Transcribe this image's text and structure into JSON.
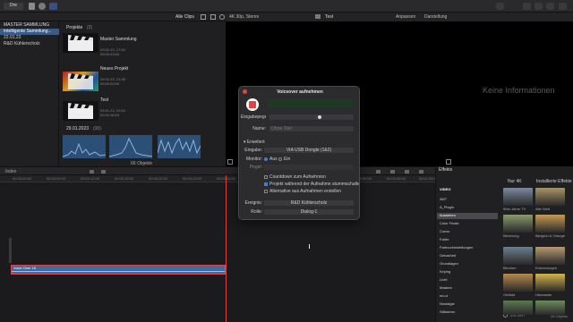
{
  "toolbar": {
    "left_label": "Dre",
    "keywords_clips": "Alle Clips",
    "viewer_format": "4K 30p, Stereo",
    "project_name": "Test",
    "view_menu": "Anpassen",
    "display_menu": "Darstellung"
  },
  "libraries": {
    "header": "MASTER SAMMLUNG",
    "items": [
      {
        "label": "Intelligente Sammlung..."
      },
      {
        "label": "22.01.23"
      },
      {
        "label": "R&D Kühlerscholz"
      }
    ]
  },
  "browser": {
    "projects_header": "Projekte",
    "projects_count": "(3)",
    "projects": [
      {
        "name": "Master Sammlung",
        "date": "29.01.23, 17:54",
        "duration": "00:00:43:03"
      },
      {
        "name": "Neues Projekt",
        "date": "29.01.23, 21:48",
        "duration": "00:00:00:00"
      },
      {
        "name": "Test",
        "date": "29.01.23, 21:53",
        "duration": "00:01:08:16"
      }
    ],
    "date_group": "29.01.2023",
    "date_group_count": "(30)",
    "footer": "66 Objekte"
  },
  "viewer": {
    "no_info": "Keine Informationen"
  },
  "timeline": {
    "label": "Index",
    "ruler_ticks": [
      "00:00:00:00",
      "00:00:05:00",
      "00:00:10:00",
      "00:00:15:00",
      "00:00:20:00",
      "00:00:25:00",
      "00:00:30:00",
      "00:00:35:00",
      "00:00:40:00",
      "00:00:45:00",
      "00:00:50:00",
      "00:00:55:00",
      "00:01:00:00"
    ],
    "clip_label": "Voice Over 16"
  },
  "dialog": {
    "title": "Voiceover aufnehmen",
    "input_level_label": "Eingabepegel",
    "name_label": "Name:",
    "name_placeholder": "Ohne Titel",
    "advanced_label": "Erweitert",
    "input_label": "Eingabe:",
    "input_value": "VIA USB Dongle (1&2)",
    "monitor_label": "Monitor:",
    "monitor_off": "Aus",
    "monitor_on": "Ein",
    "gain_label": "Pegel:",
    "check_countdown": "Countdown zum Aufnehmen",
    "check_mute": "Projekt während der Aufnahme stummschalten",
    "check_takes": "Alternative aus Aufnahmen erstellen",
    "event_label": "Ereignis:",
    "event_value": "R&D Kühlerscholz",
    "role_label": "Rolle:",
    "role_value": "Dialog-1"
  },
  "effects": {
    "title": "Effekte",
    "only_4k": "Nur 4K",
    "all_effects": "Installierte Effekte",
    "categories": [
      "VIDEO",
      "360°",
      "A_Plugin",
      "Aussehen",
      "Color Finale",
      "Comic",
      "Farbe",
      "Farbvoreinstellungen",
      "Gekachelt",
      "Grundlagen",
      "Keying",
      "Licht",
      "Masken",
      "mLut",
      "Nostalgie",
      "Stilisieren"
    ],
    "selected_category": "Aussehen",
    "items": [
      {
        "name": "50er Jahre TV",
        "color": "#7c8aa0"
      },
      {
        "name": "Alte Welt",
        "color": "#a89668"
      },
      {
        "name": "Bleichung",
        "color": "#8b9a6e"
      },
      {
        "name": "Bleigrün & Orange",
        "color": "#c79a52"
      },
      {
        "name": "Blechen",
        "color": "#6a7f8c"
      },
      {
        "name": "Erinnerungen",
        "color": "#b59a72"
      },
      {
        "name": "Gefärbt",
        "color": "#b58a4e"
      },
      {
        "name": "Hitzewelle",
        "color": "#d4b44a"
      },
      {
        "name": "",
        "color": "#5b7a4f"
      },
      {
        "name": "",
        "color": "#6e8a5a"
      }
    ],
    "search_placeholder": "Suchen",
    "count": "28 Objekte"
  }
}
